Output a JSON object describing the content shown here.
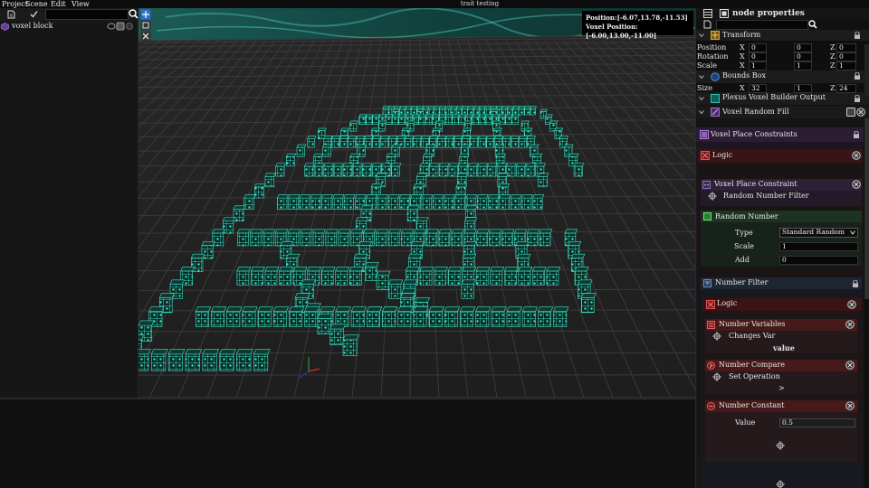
{
  "menu": {
    "items": [
      "Project",
      "Scene",
      "Edit",
      "View"
    ],
    "window_title": "trait testing"
  },
  "left_panel": {
    "search_value": "",
    "tree": [
      {
        "label": "voxel block"
      }
    ]
  },
  "viewport": {
    "position_label": "Position:",
    "position_value": "[-6.07,13.78,-11.53]",
    "voxel_position_label": "Voxel Position:",
    "voxel_position_value": "[-6.00,13.00,-11.00]"
  },
  "properties": {
    "title": "node properties",
    "search_value": "",
    "transform": {
      "label": "Transform",
      "rows": [
        {
          "label": "Position",
          "x": "0",
          "y": "0",
          "z": "0"
        },
        {
          "label": "Rotation",
          "x": "0",
          "y": "0",
          "z": "0"
        },
        {
          "label": "Scale",
          "x": "1",
          "y": "1",
          "z": "1"
        }
      ]
    },
    "bounds_box": {
      "label": "Bounds Box",
      "row": {
        "label": "Size",
        "x": "32",
        "y": "1",
        "z": "24"
      }
    },
    "builder_output": {
      "label": "Plexus Voxel Builder Output"
    },
    "random_fill": {
      "label": "Voxel Random Fill"
    },
    "axis": {
      "x": "X",
      "y": "Y",
      "z": "Z"
    },
    "graph": {
      "place_constraints": "Voxel Place Constraints",
      "logic": "Logic",
      "place_constraint": "Voxel Place Constraint",
      "random_number_filter": "Random Number Filter",
      "random_number": {
        "label": "Random Number",
        "type_label": "Type",
        "type_value": "Standard Random",
        "scale_label": "Scale",
        "scale_value": "1",
        "add_label": "Add",
        "add_value": "0"
      },
      "number_filter": "Number Filter",
      "logic2": "Logic",
      "number_variables": "Number Variables",
      "changes_var": "Changes Var",
      "value_text": "value",
      "number_compare": "Number Compare",
      "set_operation": "Set Operation",
      "operator": ">",
      "number_constant": {
        "label": "Number Constant",
        "value_label": "Value",
        "value": "0.5"
      }
    }
  },
  "colors": {
    "voxel": "#3fe0c0",
    "accent_purple": "#6a3a8a",
    "accent_red": "#7a1a1a",
    "accent_green": "#2e7d32"
  }
}
